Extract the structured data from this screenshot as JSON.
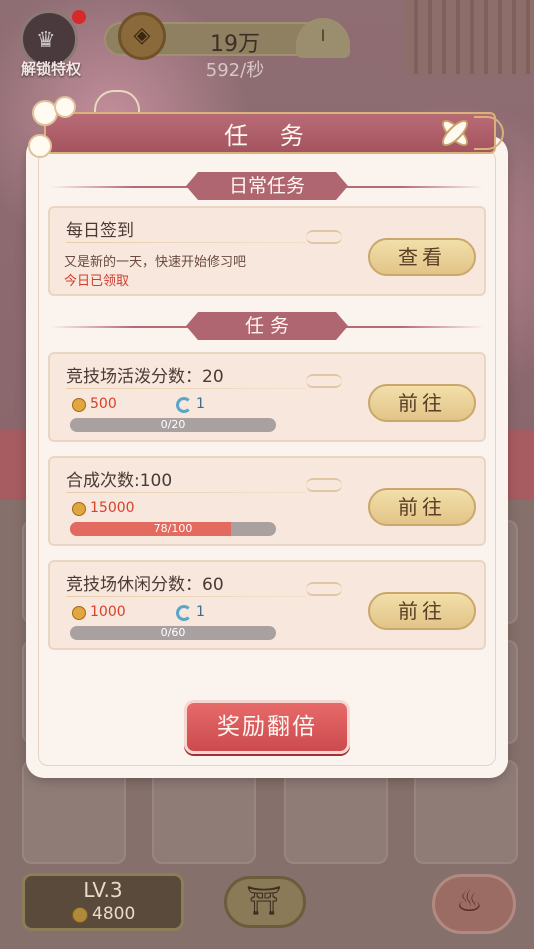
{
  "header": {
    "unlock_privilege_label": "解锁特权",
    "coin_amount": "19万",
    "coin_rate": "592/秒",
    "coin_symbol": "◈",
    "fan_symbol": "I"
  },
  "bottom_bar": {
    "level": "LV.3",
    "level_coins": "4800"
  },
  "modal": {
    "title": "任 务",
    "daily_section": "日常任务",
    "task_section": "任 务",
    "daily_task": {
      "title": "每日签到",
      "desc": "又是新的一天，快速开始修习吧",
      "status": "今日已领取",
      "button": "查看"
    },
    "tasks": [
      {
        "title": "竞技场活泼分数：20",
        "coin_reward": "500",
        "refresh_reward": "1",
        "progress_text": "0/20",
        "progress_value": 0,
        "progress_max": 20,
        "button": "前往"
      },
      {
        "title": "合成次数:100",
        "coin_reward": "15000",
        "progress_text": "78/100",
        "progress_value": 78,
        "progress_max": 100,
        "button": "前往"
      },
      {
        "title": "竞技场休闲分数：60",
        "coin_reward": "1000",
        "refresh_reward": "1",
        "progress_text": "0/60",
        "progress_value": 0,
        "progress_max": 60,
        "button": "前往"
      }
    ],
    "double_reward_button": "奖励翻倍"
  },
  "colors": {
    "title_banner": "#a4545f",
    "action_button": "#e9cf97",
    "double_button": "#d95458",
    "progress_fill": "#e26a5e",
    "reward_text": "#d8412a"
  }
}
